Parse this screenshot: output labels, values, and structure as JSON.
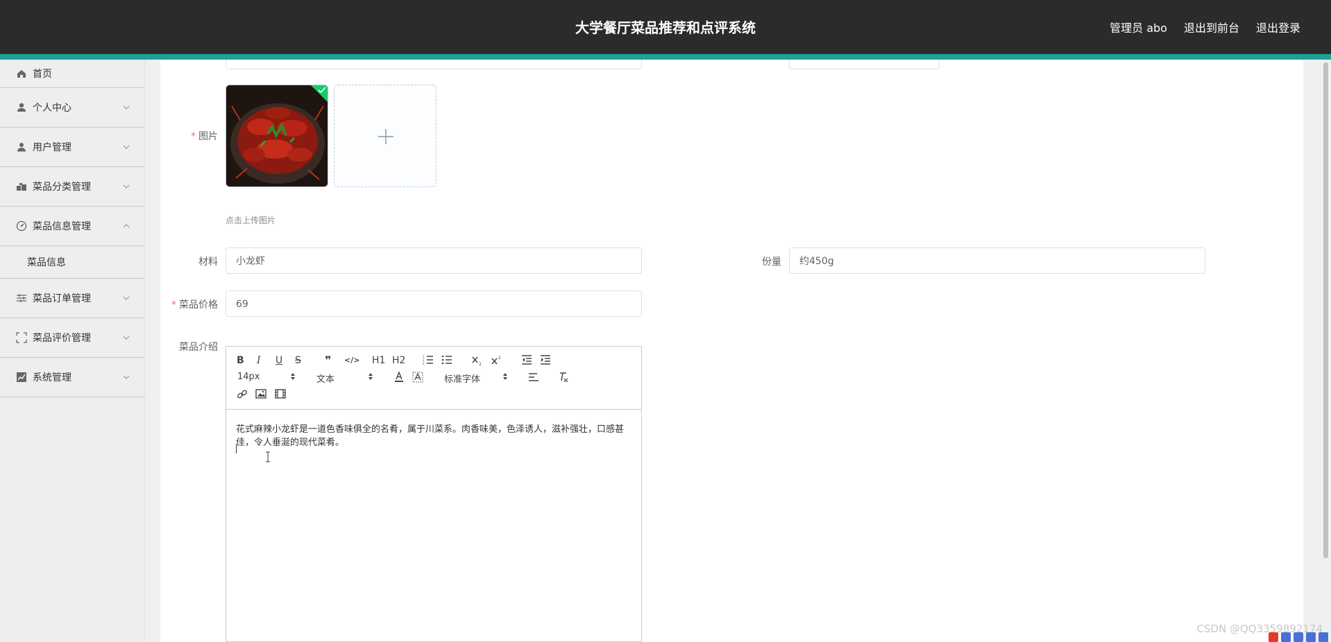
{
  "header": {
    "title": "大学餐厅菜品推荐和点评系统",
    "nav": [
      "管理员 abo",
      "退出到前台",
      "退出登录"
    ]
  },
  "sidebar": {
    "items": [
      {
        "label": "首页",
        "icon": "home-icon"
      },
      {
        "label": "个人中心",
        "icon": "user-icon"
      },
      {
        "label": "用户管理",
        "icon": "user-manage-icon"
      },
      {
        "label": "菜品分类管理",
        "icon": "category-icon"
      },
      {
        "label": "菜品信息管理",
        "icon": "gauge-icon",
        "expanded": true,
        "children": [
          "菜品信息"
        ]
      },
      {
        "label": "菜品订单管理",
        "icon": "sliders-icon"
      },
      {
        "label": "菜品评价管理",
        "icon": "fullscreen-icon"
      },
      {
        "label": "系统管理",
        "icon": "chart-icon"
      }
    ]
  },
  "form": {
    "image_label": "图片",
    "upload_tip": "点击上传图片",
    "material_label": "材料",
    "material_value": "小龙虾",
    "portion_label": "份量",
    "portion_value": "约450g",
    "price_label": "菜品价格",
    "price_value": "69",
    "intro_label": "菜品介绍",
    "intro_text_line1": "花式麻辣小龙虾是一道色香味俱全的名肴，属于川菜系。肉香味美，色泽诱人，滋补强壮，口感甚",
    "intro_text_line2": "佳，令人垂涎的现代菜肴。"
  },
  "editor": {
    "font_size": "14px",
    "header_select": "文本",
    "font_family": "标准字体",
    "buttons": [
      "B",
      "I",
      "U",
      "S",
      "❞",
      "</>",
      "H1",
      "H2"
    ]
  },
  "watermark": "CSDN @QQ3359892174",
  "colors": {
    "topbar": "#2b2b2b",
    "accent": "#1fa092",
    "required": "#f56c6c"
  }
}
